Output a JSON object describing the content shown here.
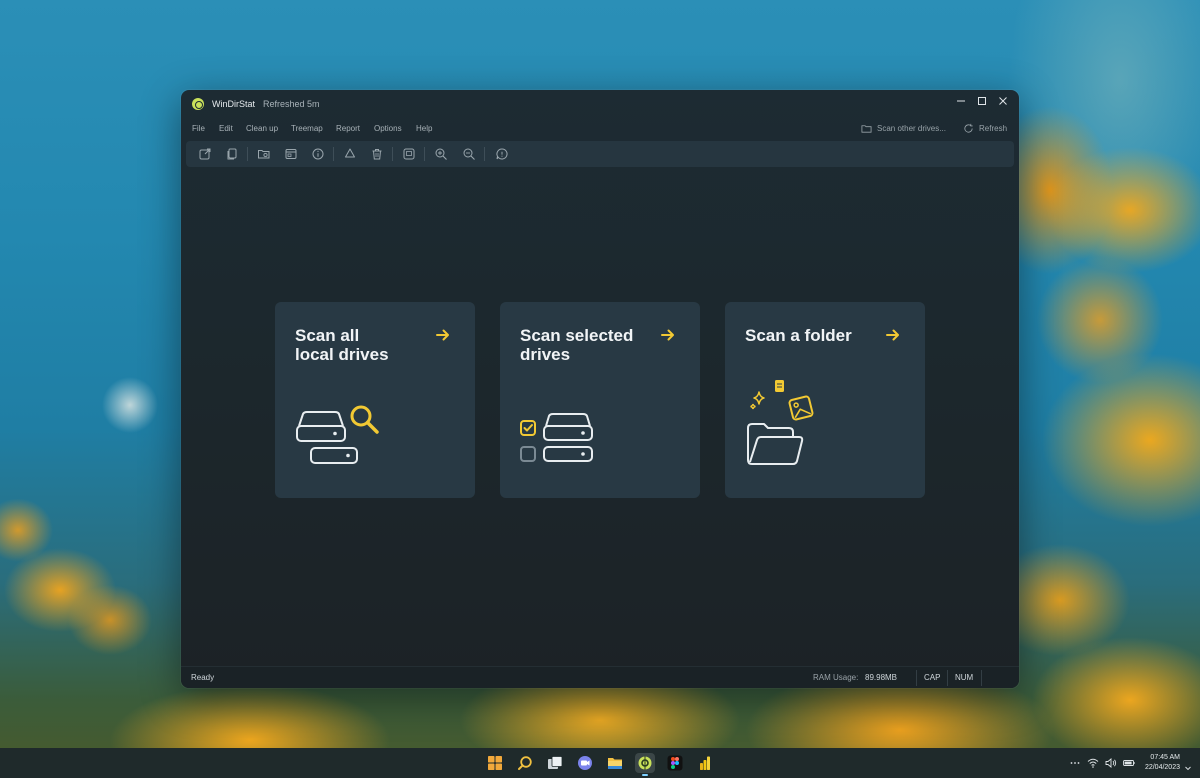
{
  "window": {
    "title": "WinDirStat",
    "subtitle": "Refreshed 5m"
  },
  "menu": {
    "items": [
      "File",
      "Edit",
      "Clean up",
      "Treemap",
      "Report",
      "Options",
      "Help"
    ],
    "scan_other": "Scan other drives...",
    "refresh": "Refresh"
  },
  "toolbar": {
    "buttons": [
      "open-external-icon",
      "copy-icon",
      "folder-search-icon",
      "explorer-icon",
      "info-icon",
      "recycle-icon",
      "delete-icon",
      "screenshot-icon",
      "zoom-in-icon",
      "zoom-out-icon",
      "feedback-icon"
    ]
  },
  "cards": [
    {
      "title": "Scan all local drives",
      "title_line1": "Scan all",
      "title_line2": "local drives",
      "icon": "drives-search-icon"
    },
    {
      "title": "Scan selected drives",
      "title_line1": "Scan selected",
      "title_line2": "drives",
      "icon": "drives-checklist-icon"
    },
    {
      "title": "Scan a folder",
      "title_line1": "Scan a folder",
      "title_line2": "",
      "icon": "folder-files-icon"
    }
  ],
  "status": {
    "ready": "Ready",
    "ram_label": "RAM Usage:",
    "ram_value": "89.98MB",
    "cap": "CAP",
    "num": "NUM"
  },
  "taskbar": {
    "apps": [
      "start",
      "search",
      "task-view",
      "teams",
      "file-explorer",
      "windirstat",
      "figma",
      "power-bi"
    ],
    "time": "07:45 AM",
    "date": "22/04/2023"
  },
  "colors": {
    "accent": "#f2c933",
    "window_bg": "#1c272c",
    "card_bg": "#283944",
    "text": "#f1f4f6"
  }
}
